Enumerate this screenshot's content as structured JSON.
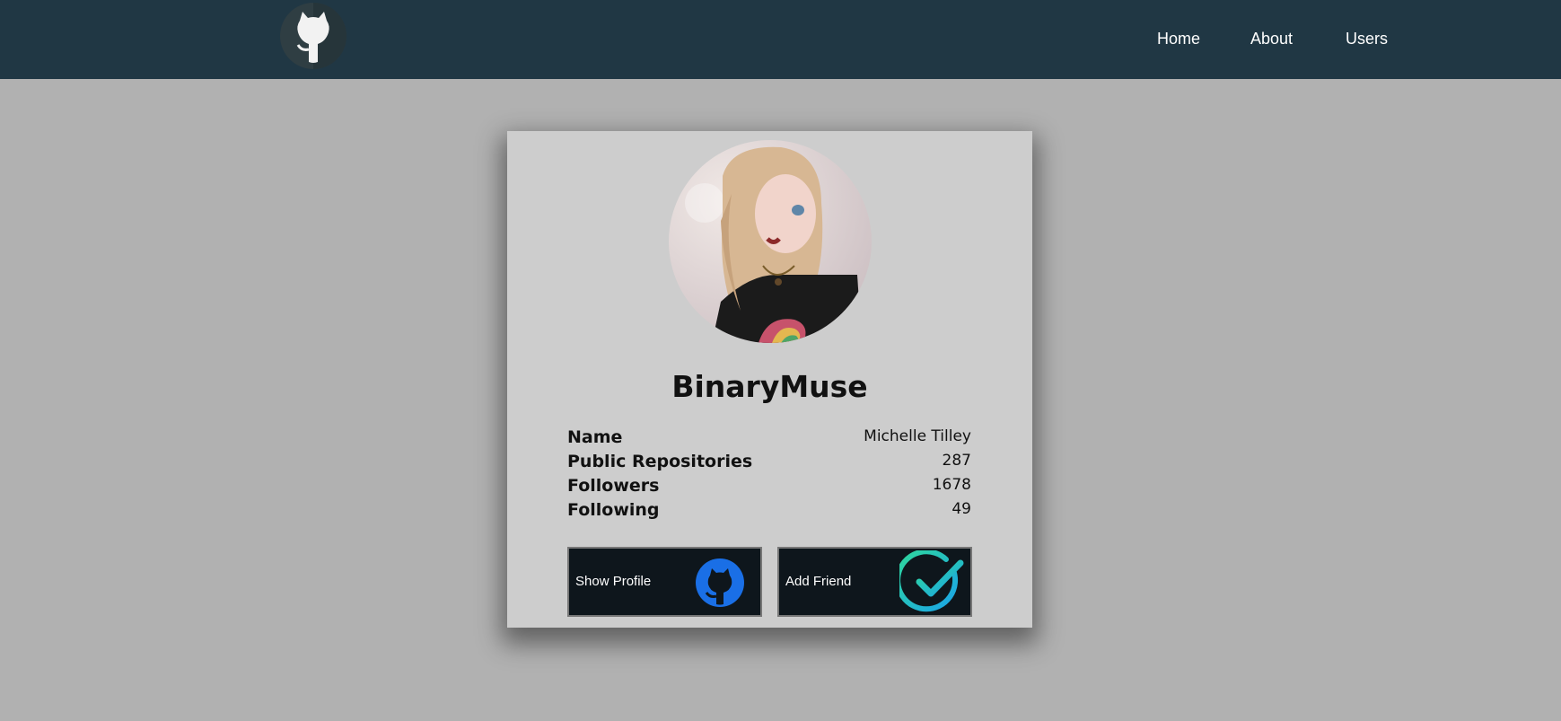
{
  "header": {
    "logo_icon": "github-octocat-icon",
    "nav": [
      {
        "label": "Home"
      },
      {
        "label": "About"
      },
      {
        "label": "Users"
      }
    ]
  },
  "profile": {
    "avatar_icon": "user-avatar-illustration",
    "username": "BinaryMuse",
    "details": [
      {
        "label": "Name",
        "value": "Michelle Tilley"
      },
      {
        "label": "Public Repositories",
        "value": "287"
      },
      {
        "label": "Followers",
        "value": "1678"
      },
      {
        "label": "Following",
        "value": "49"
      }
    ],
    "buttons": {
      "show_profile": {
        "label": "Show Profile",
        "icon": "github-icon"
      },
      "add_friend": {
        "label": "Add Friend",
        "icon": "checkmark-circle-icon"
      }
    }
  },
  "colors": {
    "navbar": "#203744",
    "page_background": "#b1b1b1",
    "card_background": "#cdcdcd",
    "button_background": "#0e161c",
    "github_icon_blue": "#1a6fe6",
    "check_gradient_start": "#2fd89b",
    "check_gradient_end": "#1aa4e8"
  }
}
